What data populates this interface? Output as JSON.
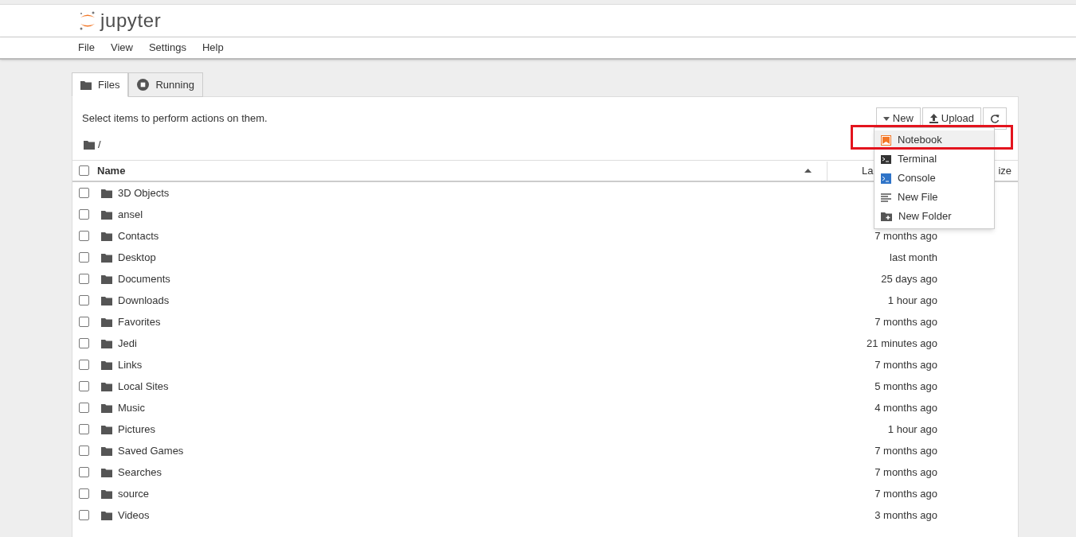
{
  "menu_bar": [
    "File",
    "View",
    "Settings",
    "Help"
  ],
  "logo": {
    "text": "jupyter"
  },
  "tabs": [
    {
      "label": "Files",
      "kind": "folder",
      "selected": true
    },
    {
      "label": "Running",
      "kind": "stop",
      "selected": false
    }
  ],
  "hint": "Select items to perform actions on them.",
  "toolbar": {
    "new": "New",
    "upload": "Upload"
  },
  "breadcrumb": "/",
  "table": {
    "select_all": {
      "checked": false
    },
    "columns": [
      {
        "label": "Name"
      },
      {
        "label": "La"
      },
      {
        "label": "ize"
      }
    ],
    "rows": [
      {
        "name": "3D Objects",
        "checked": false
      },
      {
        "name": "ansel",
        "checked": false
      },
      {
        "name": "Contacts",
        "modified": "7 months ago",
        "checked": false
      },
      {
        "name": "Desktop",
        "modified": "last month",
        "checked": false
      },
      {
        "name": "Documents",
        "modified": "25 days ago",
        "checked": false
      },
      {
        "name": "Downloads",
        "modified": "1 hour ago",
        "checked": false
      },
      {
        "name": "Favorites",
        "modified": "7 months ago",
        "checked": false
      },
      {
        "name": "Jedi",
        "modified": "21 minutes ago",
        "checked": false
      },
      {
        "name": "Links",
        "modified": "7 months ago",
        "checked": false
      },
      {
        "name": "Local Sites",
        "modified": "5 months ago",
        "checked": false
      },
      {
        "name": "Music",
        "modified": "4 months ago",
        "checked": false
      },
      {
        "name": "Pictures",
        "modified": "1 hour ago",
        "checked": false
      },
      {
        "name": "Saved Games",
        "modified": "7 months ago",
        "checked": false
      },
      {
        "name": "Searches",
        "modified": "7 months ago",
        "checked": false
      },
      {
        "name": "source",
        "modified": "7 months ago",
        "checked": false
      },
      {
        "name": "Videos",
        "modified": "3 months ago",
        "checked": false
      }
    ]
  },
  "new_menu": [
    {
      "label": "Notebook",
      "kind": "notebook",
      "highlighted": true
    },
    {
      "label": "Terminal",
      "kind": "terminal",
      "highlighted": false
    },
    {
      "label": "Console",
      "kind": "console",
      "highlighted": false
    },
    {
      "label": "New File",
      "kind": "file",
      "highlighted": false
    },
    {
      "label": "New Folder",
      "kind": "folder",
      "highlighted": false
    }
  ]
}
